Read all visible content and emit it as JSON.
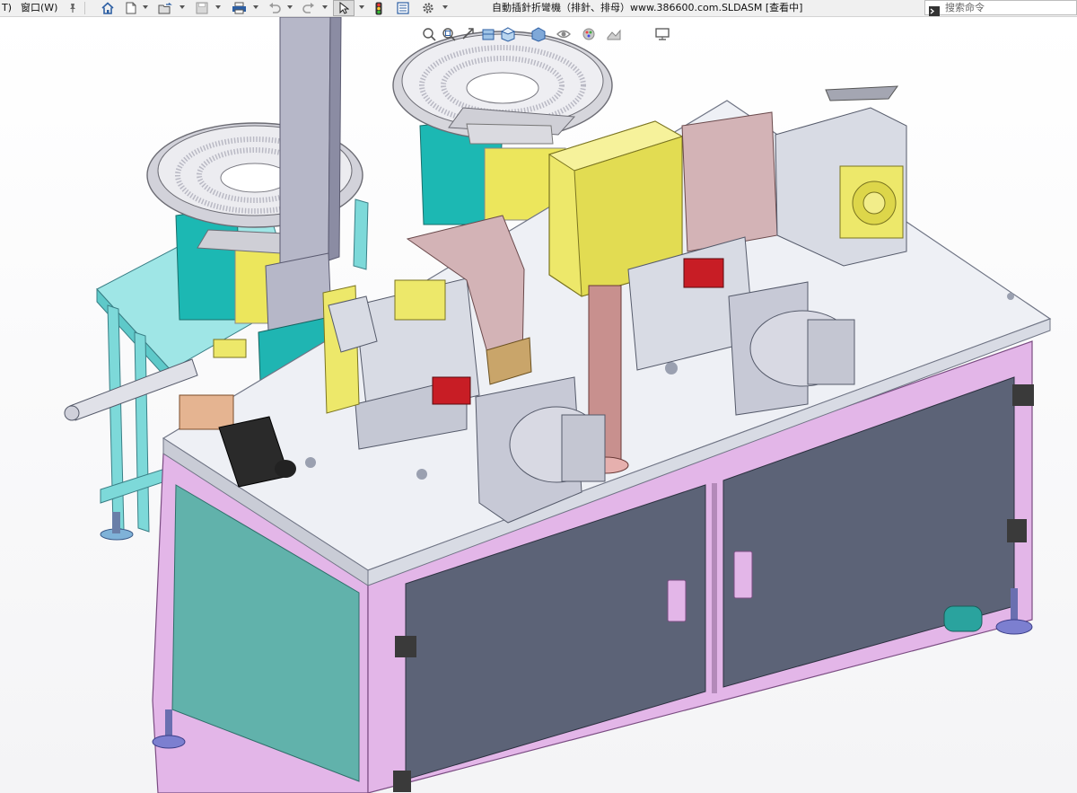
{
  "menu": {
    "tools_fragment": "T)",
    "window_label": "窗口(W)"
  },
  "window": {
    "title": "自動插針折彎機（排針、排母）www.386600.com.SLDASM [查看中]"
  },
  "command_search": {
    "placeholder": "搜索命令"
  },
  "toolbar": {
    "icons": [
      "pin-icon",
      "home-icon",
      "new-document-icon",
      "open-folder-icon",
      "save-icon",
      "print-icon",
      "undo-icon",
      "redo-icon",
      "select-pointer-icon",
      "traffic-light-icon",
      "file-properties-icon",
      "options-gear-icon"
    ]
  },
  "heads_up_view_toolbar": {
    "icons": [
      "zoom-to-fit-icon",
      "zoom-area-icon",
      "previous-view-icon",
      "section-view-icon",
      "view-orientation-icon",
      "display-style-icon",
      "hide-show-icon",
      "edit-appearance-icon",
      "apply-scene-icon",
      "view-settings-icon",
      "monitor-icon"
    ]
  },
  "colors": {
    "frame_profile": "#e3b6e8",
    "cabinet_panel": "#5c6377",
    "side_panel": "#61b2ab",
    "table_top": "#eef0f5",
    "stand": "#8de0e0",
    "feeder_bowl": "#cfcfd6",
    "feeder_base": "#1cb8b3",
    "yellow_block": "#ede86a",
    "red_block": "#c81d25",
    "motor": "#d8d9e3"
  }
}
